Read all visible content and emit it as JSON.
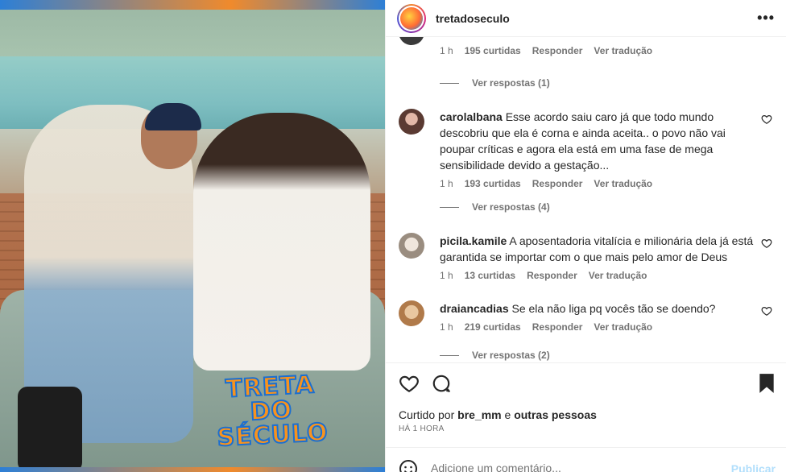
{
  "post": {
    "username": "tretadoseculo",
    "watermark": "TRETA DO SÉCULO",
    "avatar_icon": "brand-logo-icon",
    "more_icon_glyph": "•••"
  },
  "comments": [
    {
      "id": "c0",
      "partial": true,
      "time": "1 h",
      "likes": "195 curtidas",
      "reply": "Responder",
      "translate": "Ver tradução",
      "replies": "Ver respostas (1)"
    },
    {
      "id": "c1",
      "username": "carolalbana",
      "text": "Esse acordo saiu caro já que todo mundo descobriu que ela é corna e ainda aceita.. o povo não vai poupar críticas e agora ela está em uma fase de mega sensibilidade devido a gestação...",
      "time": "1 h",
      "likes": "193 curtidas",
      "reply": "Responder",
      "translate": "Ver tradução",
      "replies": "Ver respostas (4)",
      "avatar_color": "#5a3a32"
    },
    {
      "id": "c2",
      "username": "picila.kamile",
      "text": "A aposentadoria vitalícia e milionária dela já está garantida se importar com o que mais pelo amor de Deus",
      "time": "1 h",
      "likes": "13 curtidas",
      "reply": "Responder",
      "translate": "Ver tradução",
      "avatar_color": "#9a8d80"
    },
    {
      "id": "c3",
      "username": "draiancadias",
      "text": "Se ela não liga pq vocês tão se doendo?",
      "time": "1 h",
      "likes": "219 curtidas",
      "reply": "Responder",
      "translate": "Ver tradução",
      "replies": "Ver respostas (2)",
      "avatar_color": "#b07a4a"
    }
  ],
  "footer": {
    "liked_prefix": "Curtido por",
    "liked_user": "bre_mm",
    "liked_and": "e",
    "liked_others": "outras pessoas",
    "time_ago": "HÁ 1 HORA",
    "comment_placeholder": "Adicione um comentário...",
    "publish_label": "Publicar"
  },
  "colors": {
    "text": "#262626",
    "muted": "#737373",
    "publish_disabled": "#b2dffc",
    "border": "#efefef"
  }
}
